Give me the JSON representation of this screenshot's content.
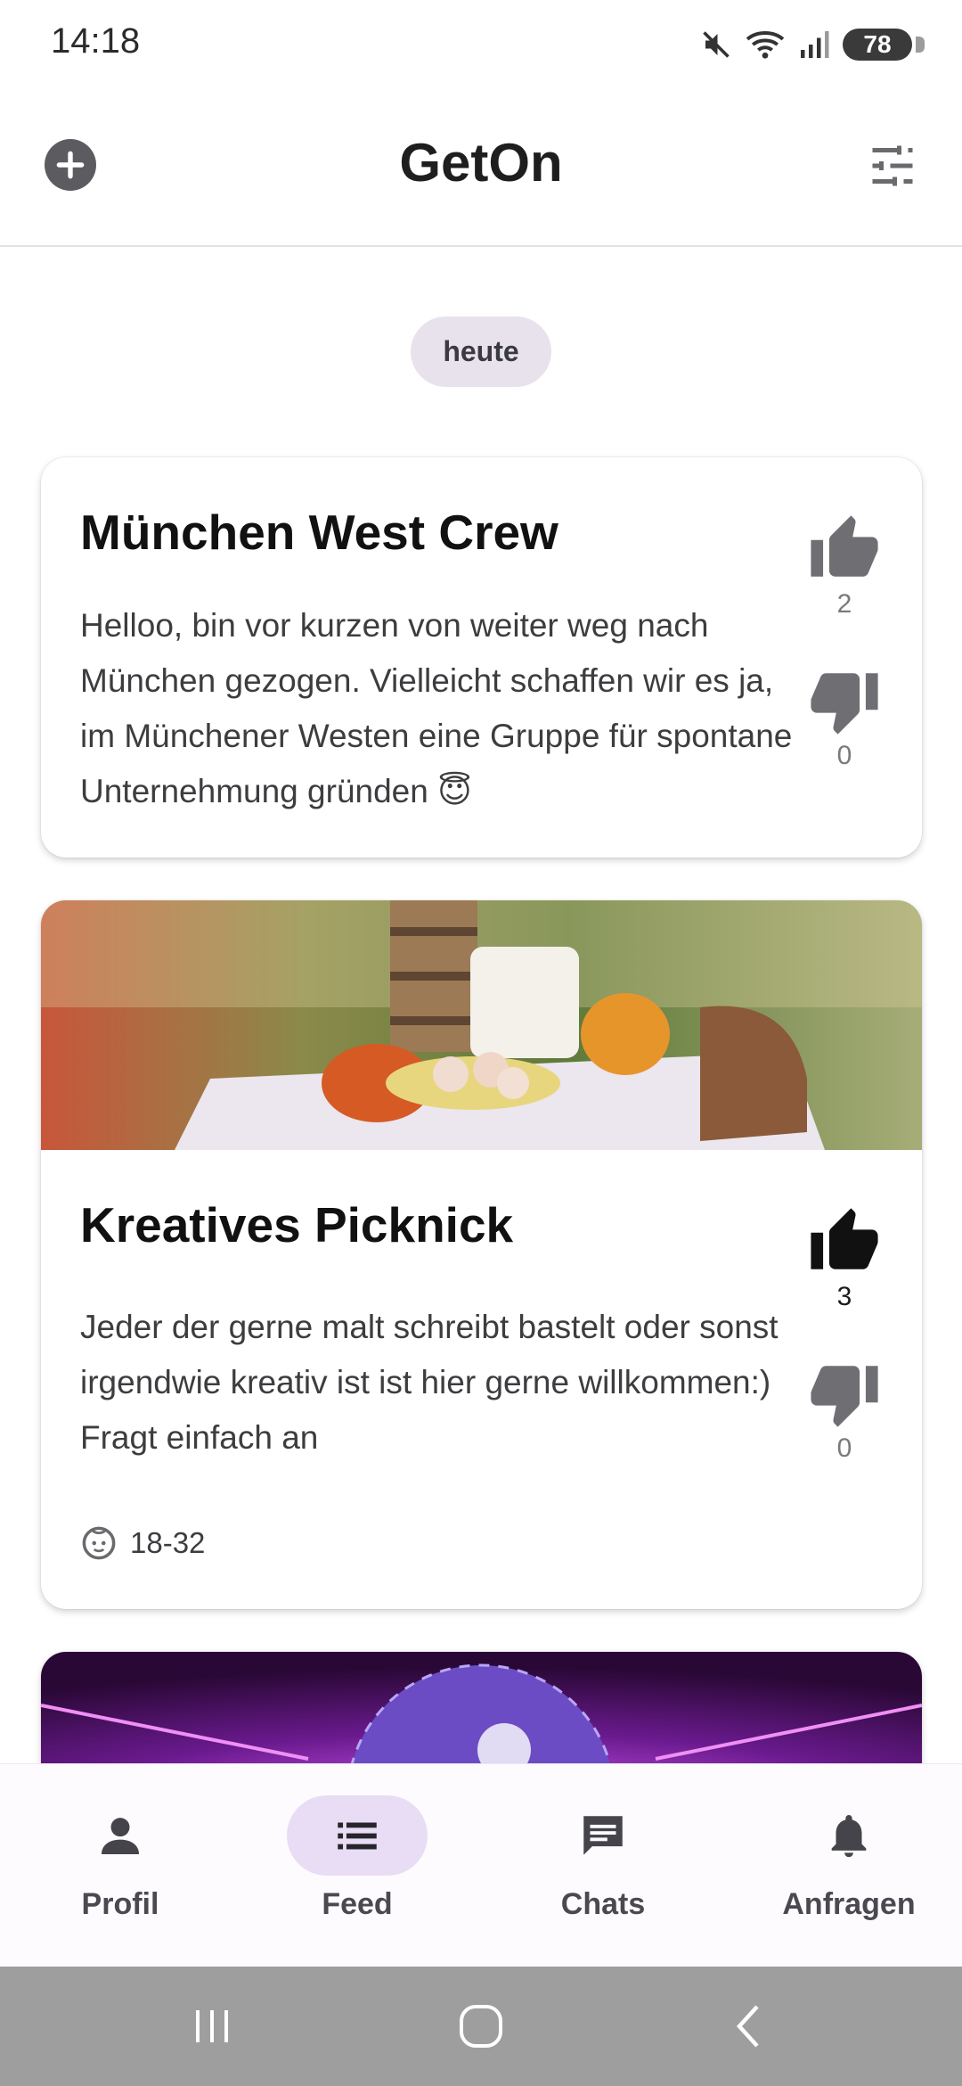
{
  "status_bar": {
    "time": "14:18",
    "battery": "78",
    "icons": [
      "mute-icon",
      "wifi-icon",
      "signal-icon",
      "battery-icon"
    ]
  },
  "app_bar": {
    "title": "GetOn",
    "left_icon": "add-circle-icon",
    "right_icon": "tune-icon"
  },
  "feed": {
    "date_label": "heute",
    "posts": [
      {
        "title": "München West Crew",
        "text": "Helloo, bin vor kurzen von weiter weg nach München gezogen. Vielleicht schaffen wir es ja, im Münchener Westen eine Gruppe für spontane Unternehmung gründen 😇",
        "likes": "2",
        "dislikes": "0",
        "liked": false
      },
      {
        "title": "Kreatives Picknick",
        "text_lines": [
          "Jeder der gerne malt schreibt bastelt oder sonst irgendwie kreativ ist ist hier gerne willkommen:)",
          "Fragt einfach an"
        ],
        "likes": "3",
        "dislikes": "0",
        "liked": true,
        "age_range": "18-32",
        "image": "picnic-photo"
      },
      {
        "image": "disco-ball-photo"
      }
    ]
  },
  "bottom_nav": {
    "items": [
      {
        "label": "Profil",
        "icon": "person-icon"
      },
      {
        "label": "Feed",
        "icon": "list-icon",
        "active": true
      },
      {
        "label": "Chats",
        "icon": "chat-icon"
      },
      {
        "label": "Anfragen",
        "icon": "bell-icon"
      }
    ]
  },
  "colors": {
    "accent_pill": "#e8ddf5",
    "chip": "#e8e2ec",
    "system_nav": "#9e9e9e"
  }
}
